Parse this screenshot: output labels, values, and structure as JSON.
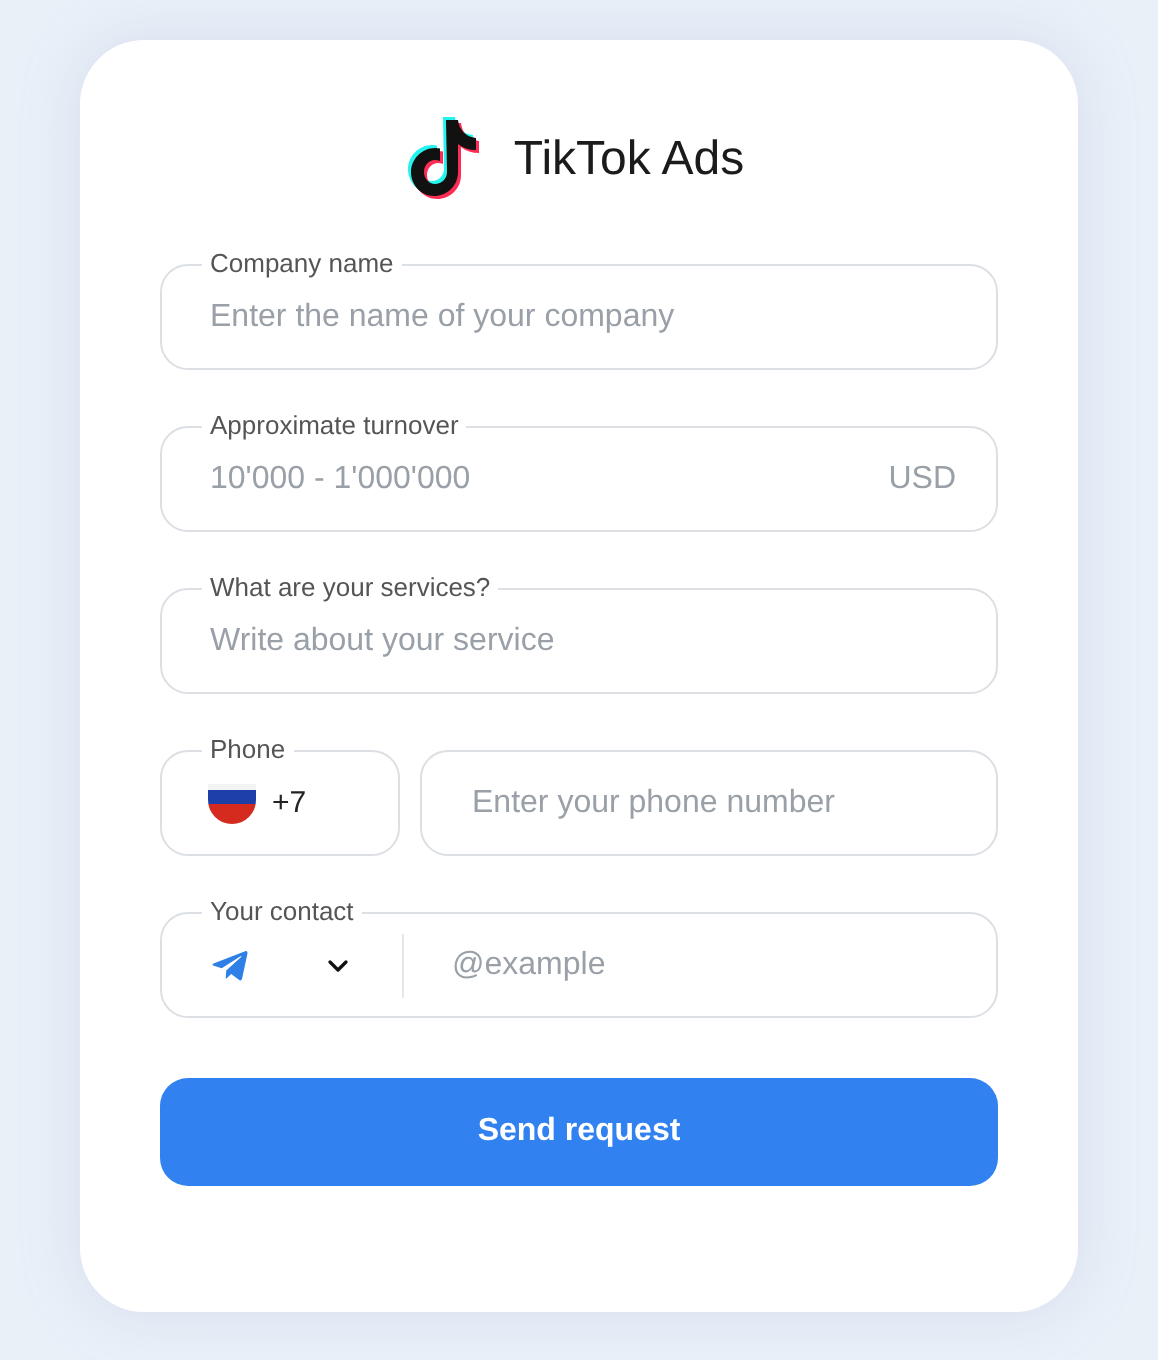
{
  "brand": {
    "name": "TikTok Ads"
  },
  "fields": [
    {
      "kind": "text",
      "label": "Company name",
      "placeholder": "Enter the name of your company"
    },
    {
      "kind": "currency",
      "label": "Approximate turnover",
      "placeholder": "10'000 - 1'000'000",
      "suffix": "USD"
    },
    {
      "kind": "text",
      "label": "What are your services?",
      "placeholder": "Write about your service"
    }
  ],
  "phone": {
    "label": "Phone",
    "code": "+7",
    "placeholder": "Enter your phone number"
  },
  "contact": {
    "label": "Your contact",
    "placeholder": "@example"
  },
  "submit": "Send request"
}
